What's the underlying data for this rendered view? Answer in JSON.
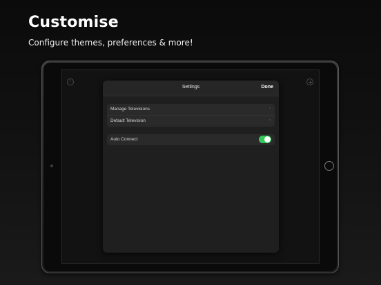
{
  "headline": "Customise",
  "subheadline": "Configure themes, preferences & more!",
  "settings_modal": {
    "title": "Settings",
    "done_label": "Done",
    "groups": [
      {
        "rows": [
          {
            "label": "Manage Televisions",
            "accessory": "chevron-right-icon"
          },
          {
            "label": "Default Television",
            "accessory": "chevron-right-icon"
          }
        ]
      },
      {
        "rows": [
          {
            "label": "Auto Connect",
            "accessory": "toggle",
            "toggle_on": true
          }
        ]
      }
    ]
  },
  "screen_icons": {
    "left": "info-icon",
    "right": "add-icon"
  },
  "colors": {
    "toggle_on": "#34c759",
    "background": "#111111",
    "modal": "#1f1f1f"
  }
}
